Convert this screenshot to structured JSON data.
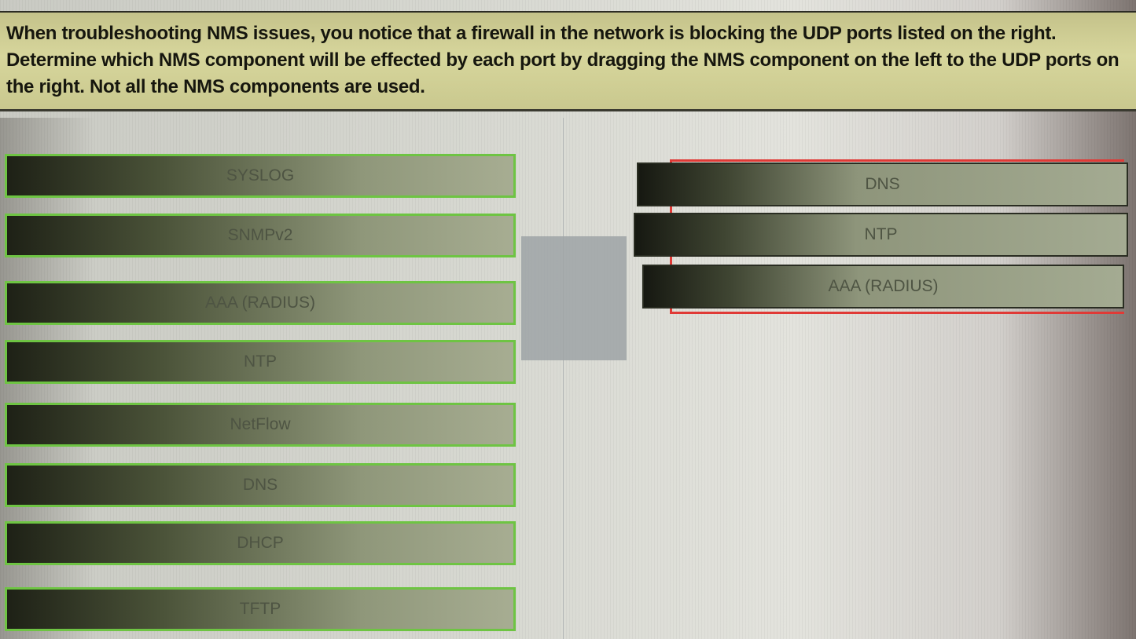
{
  "instruction": {
    "text": "When troubleshooting NMS issues, you notice that a firewall in the network is blocking the UDP ports listed on the right. Determine which NMS component will be effected by each port by dragging the NMS component on the left to the UDP ports on the right. Not all the NMS components are used."
  },
  "source_items": [
    {
      "label": "SYSLOG"
    },
    {
      "label": "SNMPv2"
    },
    {
      "label": "AAA (RADIUS)"
    },
    {
      "label": "NTP"
    },
    {
      "label": "NetFlow"
    },
    {
      "label": "DNS"
    },
    {
      "label": "DHCP"
    },
    {
      "label": "TFTP"
    }
  ],
  "target_items": [
    {
      "label": "DNS"
    },
    {
      "label": "NTP"
    },
    {
      "label": "AAA (RADIUS)"
    }
  ],
  "colors": {
    "source_border": "#6ec443",
    "target_border": "#e03a36",
    "instruction_bg": "#d7d69c"
  }
}
